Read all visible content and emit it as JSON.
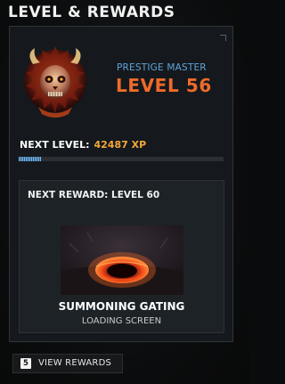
{
  "header": {
    "title": "LEVEL & REWARDS"
  },
  "profile": {
    "emblem_icon": "prestige-master-emblem-icon",
    "prestige_label": "PRESTIGE MASTER",
    "level_text": "LEVEL 56",
    "level_color": "#f06a2a",
    "prestige_color": "#5ea4dc"
  },
  "progress": {
    "next_level_label": "NEXT LEVEL:",
    "xp_text": "42487 XP",
    "xp_color": "#f3a73a",
    "fraction": 0.11
  },
  "reward": {
    "title": "NEXT REWARD: LEVEL 60",
    "image_icon": "summoning-gate-portal-icon",
    "name": "SUMMONING GATING",
    "type": "LOADING SCREEN"
  },
  "footer": {
    "key_hint": "5",
    "view_rewards_label": "VIEW REWARDS"
  }
}
